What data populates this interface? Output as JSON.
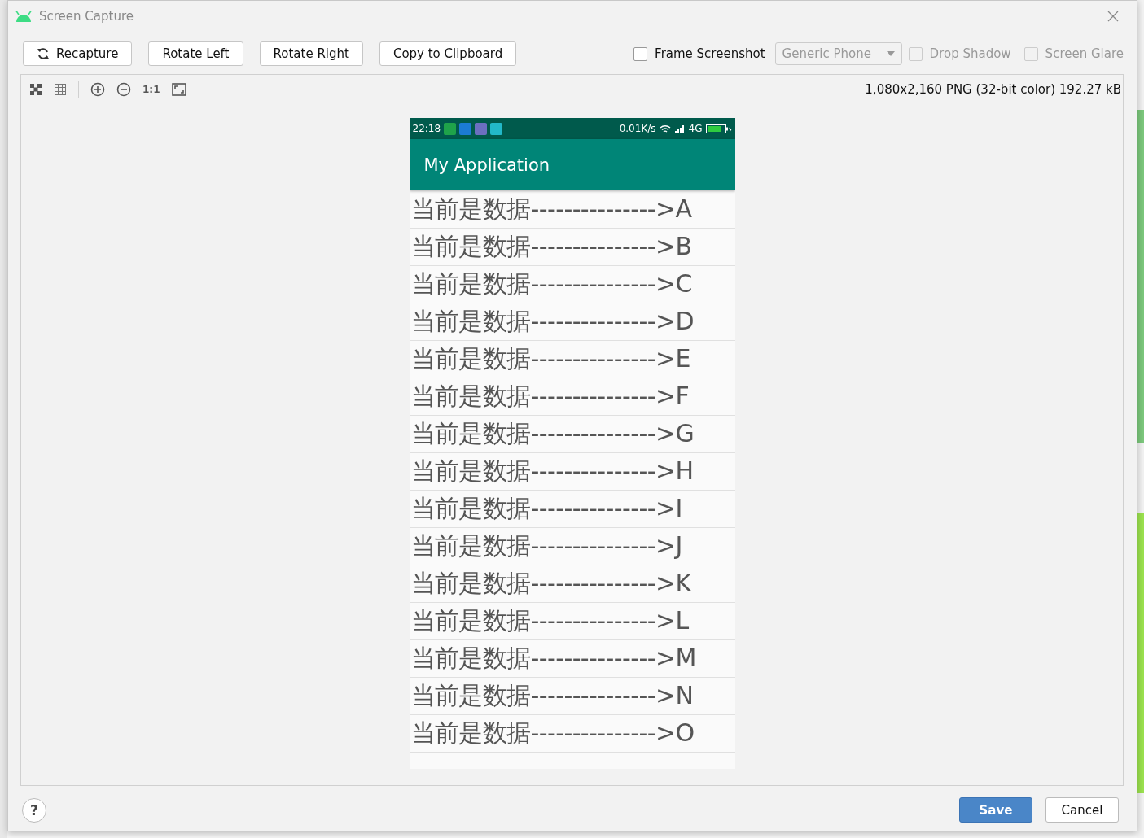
{
  "window": {
    "title": "Screen Capture"
  },
  "actions": [
    {
      "label": "Recapture"
    },
    {
      "label": "Rotate Left"
    },
    {
      "label": "Rotate Right"
    },
    {
      "label": "Copy to Clipboard"
    }
  ],
  "options": [
    {
      "kind": "checkbox",
      "label": "Frame Screenshot",
      "checked": false,
      "disabled": false
    },
    {
      "kind": "dropdown",
      "value": "Generic Phone",
      "disabled": true
    },
    {
      "kind": "checkbox",
      "label": "Drop Shadow",
      "checked": false,
      "disabled": true
    },
    {
      "kind": "checkbox",
      "label": "Screen Glare",
      "checked": false,
      "disabled": true
    }
  ],
  "viewer": {
    "zoom_label": "1:1",
    "image_info": "1,080x2,160 PNG (32-bit color) 192.27 kB"
  },
  "phone": {
    "time": "22:18",
    "net_speed": "0.01K/s",
    "network": "4G",
    "app_title": "My Application",
    "items": [
      "当前是数据--------------->A",
      "当前是数据--------------->B",
      "当前是数据--------------->C",
      "当前是数据--------------->D",
      "当前是数据--------------->E",
      "当前是数据--------------->F",
      "当前是数据--------------->G",
      "当前是数据--------------->H",
      "当前是数据--------------->I",
      "当前是数据--------------->J",
      "当前是数据--------------->K",
      "当前是数据--------------->L",
      "当前是数据--------------->M",
      "当前是数据--------------->N",
      "当前是数据--------------->O"
    ]
  },
  "footer": {
    "help": "?",
    "buttons": [
      {
        "label": "Save",
        "kind": "primary"
      },
      {
        "label": "Cancel",
        "kind": "default"
      }
    ]
  }
}
